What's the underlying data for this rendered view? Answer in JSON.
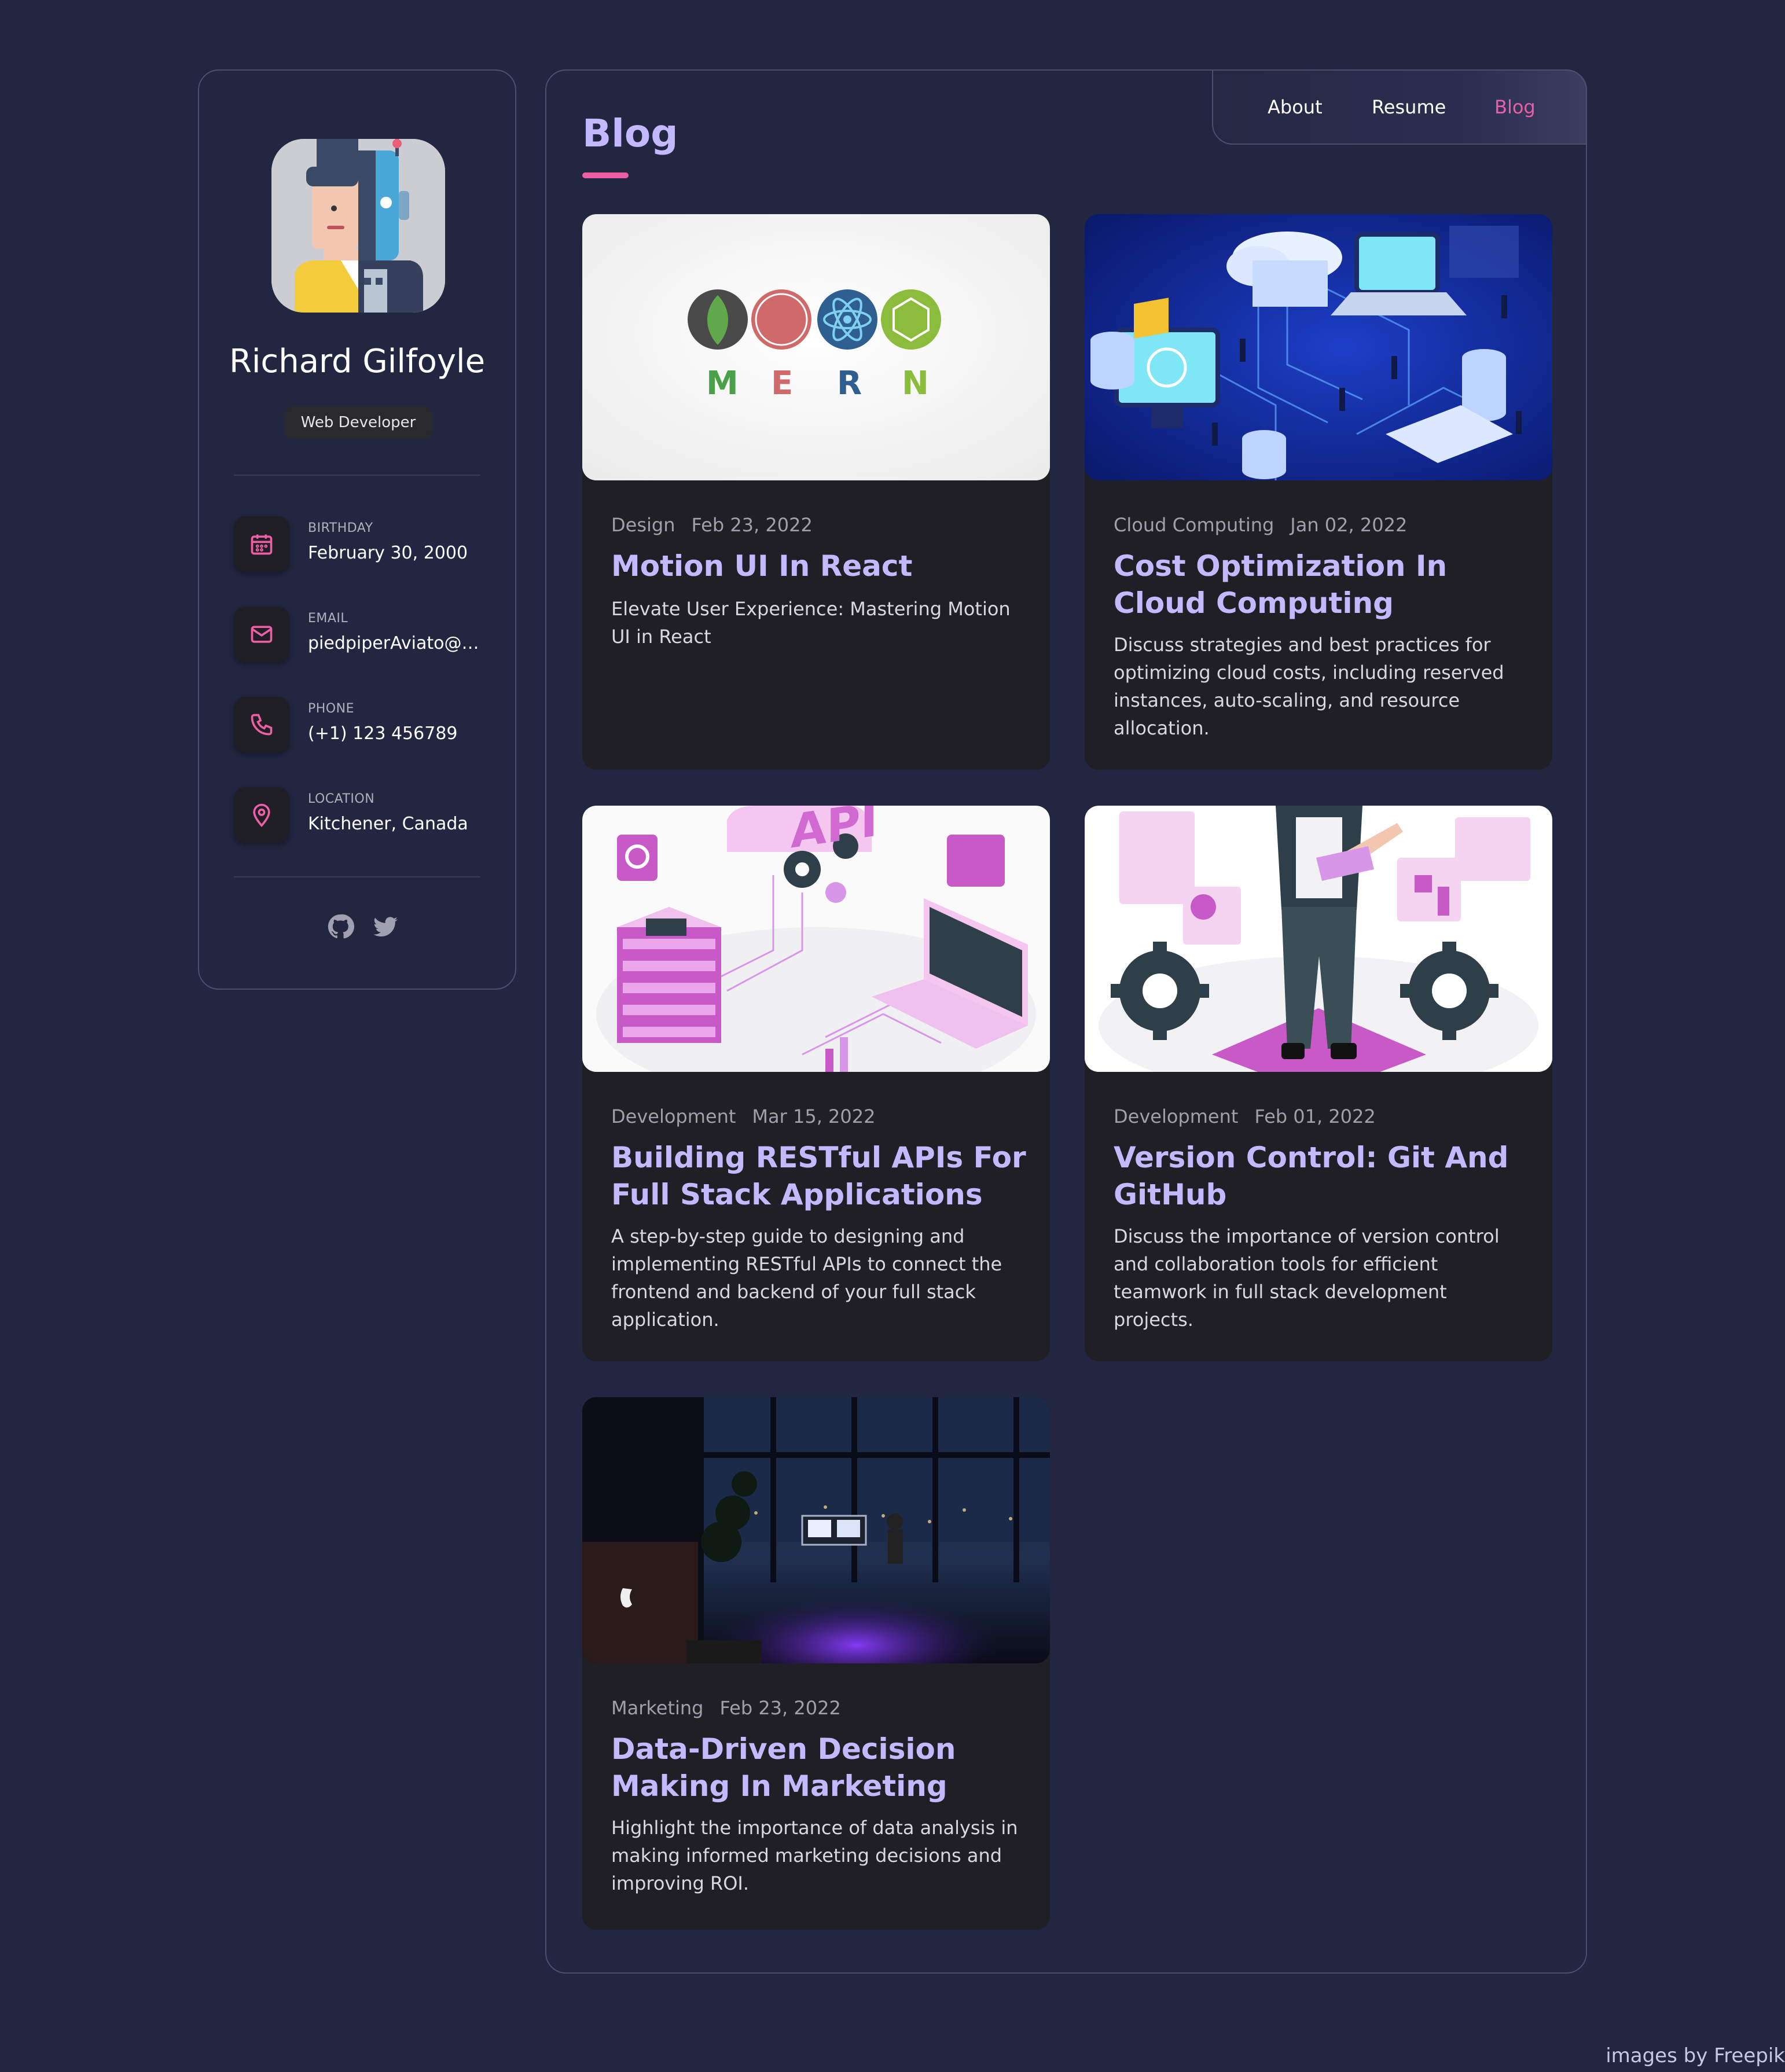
{
  "profile": {
    "name": "Richard Gilfoyle",
    "role": "Web Developer",
    "contacts": [
      {
        "label": "BIRTHDAY",
        "value": "February 30, 2000",
        "icon": "calendar-icon"
      },
      {
        "label": "EMAIL",
        "value": "piedpiperAviato@gmail.com",
        "icon": "mail-icon"
      },
      {
        "label": "PHONE",
        "value": "(+1) 123 456789",
        "icon": "phone-icon"
      },
      {
        "label": "LOCATION",
        "value": "Kitchener, Canada",
        "icon": "location-pin-icon"
      }
    ],
    "social": [
      "github-icon",
      "twitter-icon"
    ]
  },
  "nav": {
    "items": [
      {
        "label": "About"
      },
      {
        "label": "Resume"
      },
      {
        "label": "Blog"
      }
    ],
    "active": "Blog"
  },
  "page": {
    "title": "Blog"
  },
  "posts": [
    {
      "category": "Design",
      "date": "Feb 23, 2022",
      "title": "Motion UI In React",
      "description": "Elevate User Experience: Mastering Motion UI in React",
      "image_text": [
        "M",
        "E",
        "R",
        "N"
      ]
    },
    {
      "category": "Cloud Computing",
      "date": "Jan 02, 2022",
      "title": "Cost Optimization In Cloud Computing",
      "description": "Discuss strategies and best practices for optimizing cloud costs, including reserved instances, auto-scaling, and resource allocation."
    },
    {
      "category": "Development",
      "date": "Mar 15, 2022",
      "title": "Building RESTful APIs For Full Stack Applications",
      "description": "A step-by-step guide to designing and implementing RESTful APIs to connect the frontend and backend of your full stack application.",
      "image_text": "API"
    },
    {
      "category": "Development",
      "date": "Feb 01, 2022",
      "title": "Version Control: Git And GitHub",
      "description": "Discuss the importance of version control and collaboration tools for efficient teamwork in full stack development projects."
    },
    {
      "category": "Marketing",
      "date": "Feb 23, 2022",
      "title": "Data-Driven Decision Making In Marketing",
      "description": "Highlight the importance of data analysis in making informed marketing decisions and improving ROI."
    }
  ],
  "footer": {
    "credit": "images by Freepik"
  },
  "colors": {
    "background": "#222640",
    "accent": "#ec5fa6",
    "title": "#c4b8ff",
    "card": "#1f1f25",
    "border": "#4a4f72"
  }
}
